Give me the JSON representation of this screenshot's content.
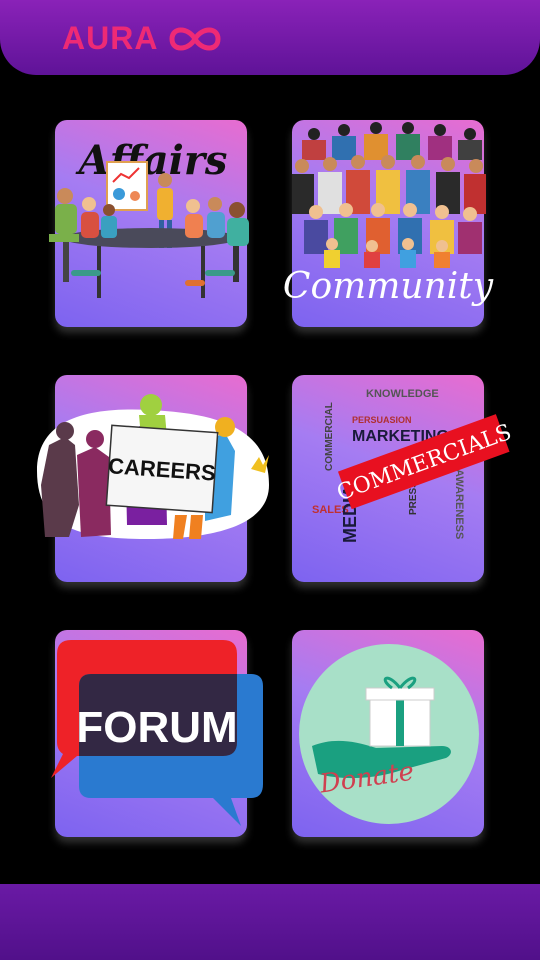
{
  "header": {
    "logo_text": "AURA"
  },
  "tiles": [
    {
      "label": "Affairs"
    },
    {
      "label": "Community"
    },
    {
      "label": "CAREERS"
    },
    {
      "label": "COMMERCIALS"
    },
    {
      "label": "FORUM"
    },
    {
      "label": "Donate"
    }
  ],
  "commercials_words": {
    "w1": "MARKETING",
    "w2": "MEDIA",
    "w3": "PERSUASION",
    "w4": "KNOWLEDGE",
    "w5": "PRESS",
    "w6": "AWARENESS",
    "w7": "SALES",
    "w8": "COMMERCIAL"
  },
  "colors": {
    "accent": "#ee2a75",
    "topbar": "#7a1cb0",
    "bottombar": "#5e1498",
    "tile_top": "#e86cd0",
    "tile_bottom": "#7d63f0"
  }
}
